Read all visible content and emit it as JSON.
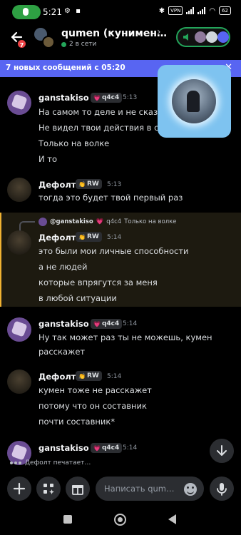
{
  "status_bar": {
    "time": "5:21",
    "vpn": "VPN",
    "battery": "62"
  },
  "header": {
    "title": "qumen (кунимен…",
    "status": "2 в сети",
    "unread_count": "7"
  },
  "new_messages_bar": {
    "text": "7 новых сообщений с 05:20",
    "close_icon": "close-icon"
  },
  "messages": [
    {
      "author": "ganstakiso",
      "tag": "q4c4",
      "tag_emoji": "💗",
      "time": "5:13",
      "lines": [
        "На самом то деле и не сказ",
        "Не видел твои действия в с",
        "Только на волке",
        "И то"
      ]
    },
    {
      "author": "Дефолт",
      "tag": "RW",
      "tag_emoji": "👏",
      "time": "5:13",
      "lines": [
        "тогда это будет твой первый раз"
      ]
    },
    {
      "reply": {
        "author": "@ganstakiso",
        "tag": "q4c4",
        "tag_emoji": "💗",
        "text": "Только на волке"
      },
      "author": "Дефолт",
      "tag": "RW",
      "tag_emoji": "👏",
      "time": "5:14",
      "lines": [
        "это были мои личные способности",
        "а не людей",
        "которые впрягутся за меня",
        "в любой ситуации"
      ]
    },
    {
      "author": "ganstakiso",
      "tag": "q4c4",
      "tag_emoji": "💗",
      "time": "5:14",
      "lines": [
        "Ну так может раз ты не можешь, кумен",
        "расскажет"
      ]
    },
    {
      "author": "Дефолт",
      "tag": "RW",
      "tag_emoji": "👏",
      "time": "5:14",
      "lines": [
        "кумен тоже не расскажет",
        "потому что он составник",
        "почти составник*"
      ]
    },
    {
      "author": "ganstakiso",
      "tag": "q4c4",
      "tag_emoji": "💗",
      "time": "5:14",
      "lines": []
    }
  ],
  "typing_indicator": "Дефолт печатает…",
  "composer": {
    "placeholder": "Написать qum…"
  },
  "colors": {
    "accent": "#5865f2",
    "online": "#23a55a",
    "reply_highlight": "#f0b232",
    "badge": "#ed4245"
  }
}
